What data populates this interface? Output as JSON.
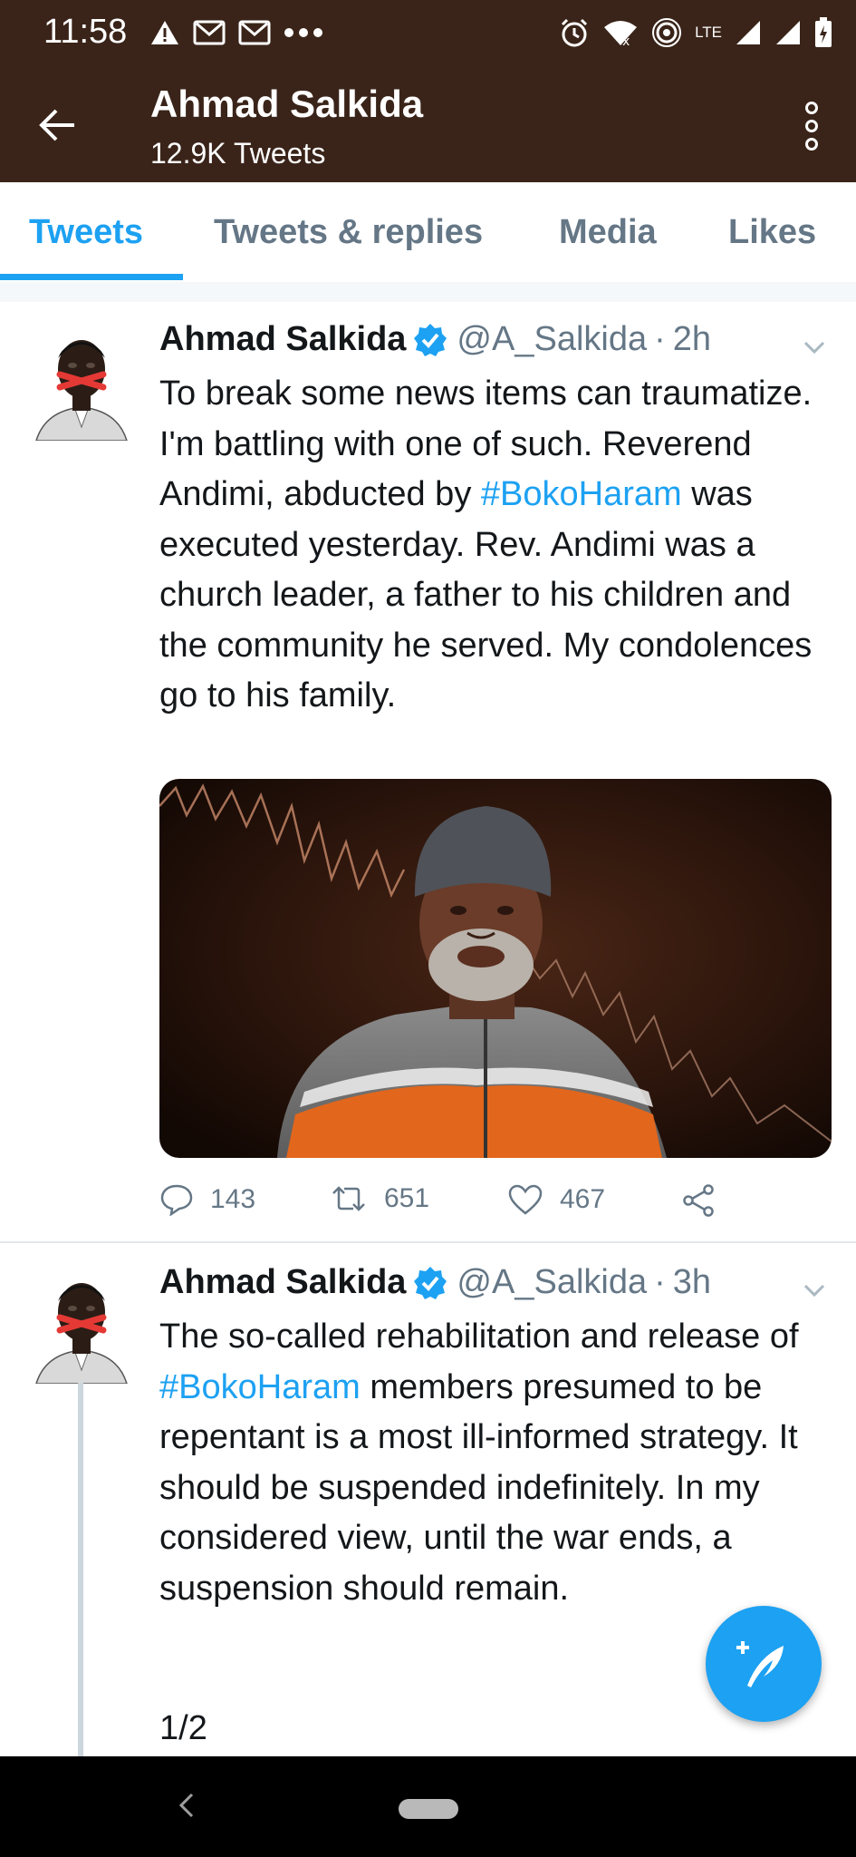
{
  "status_bar": {
    "time": "11:58",
    "network_label": "LTE"
  },
  "app_bar": {
    "title": "Ahmad Salkida",
    "subtitle": "12.9K Tweets"
  },
  "tabs": [
    {
      "label": "Tweets",
      "active": true
    },
    {
      "label": "Tweets & replies",
      "active": false
    },
    {
      "label": "Media",
      "active": false
    },
    {
      "label": "Likes",
      "active": false
    }
  ],
  "tweets": [
    {
      "name": "Ahmad Salkida",
      "handle": "@A_Salkida",
      "separator": "·",
      "time": "2h",
      "text_parts": [
        "To break some news items can traumatize. I'm battling with one of such. Reverend Andimi, abducted by ",
        "#BokoHaram",
        " was executed yesterday. Rev. Andimi was a church leader, a father to his children and the community he served. My condolences go to his family."
      ],
      "replies": "143",
      "retweets": "651",
      "likes": "467"
    },
    {
      "name": "Ahmad Salkida",
      "handle": "@A_Salkida",
      "separator": "·",
      "time": "3h",
      "text_parts": [
        "The so-called rehabilitation and release of ",
        "#BokoHaram",
        " members presumed to be repentant is a most ill-informed strategy. It should be suspended indefinitely. In my considered view, until the war ends, a suspension should remain."
      ],
      "thread_counter": "1/2"
    }
  ],
  "colors": {
    "header_bg": "#3a2419",
    "accent": "#1da1f2",
    "secondary_text": "#657786"
  }
}
